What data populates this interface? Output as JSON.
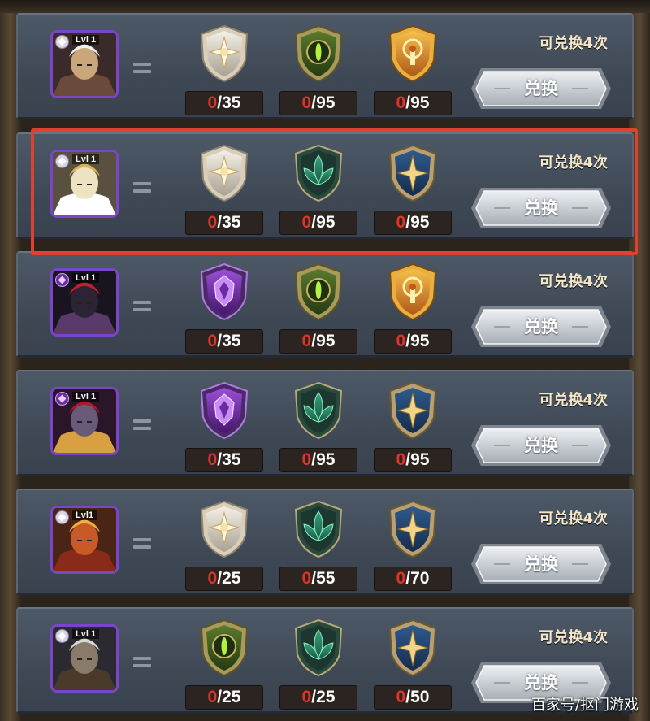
{
  "exchange_list": {
    "items": [
      {
        "hero": "hero-white-haired-warrior",
        "faction": "celestial",
        "level_label": "Lvl 1",
        "materials": [
          {
            "emblem": "star-emblem",
            "have": "0",
            "need": "/35"
          },
          {
            "emblem": "eye-emblem",
            "have": "0",
            "need": "/95"
          },
          {
            "emblem": "gold-emblem",
            "have": "0",
            "need": "/95"
          }
        ],
        "limit_text": "可兑换4次",
        "button_label": "兑换"
      },
      {
        "hero": "hero-golden-winged-knight",
        "faction": "celestial",
        "level_label": "Lvl 1",
        "materials": [
          {
            "emblem": "star-emblem",
            "have": "0",
            "need": "/35"
          },
          {
            "emblem": "lotus-emblem",
            "have": "0",
            "need": "/95"
          },
          {
            "emblem": "blue-star-emblem",
            "have": "0",
            "need": "/95"
          }
        ],
        "limit_text": "可兑换4次",
        "button_label": "兑换"
      },
      {
        "hero": "hero-dark-horned-demon",
        "faction": "hypogean",
        "level_label": "Lvl 1",
        "materials": [
          {
            "emblem": "purple-emblem",
            "have": "0",
            "need": "/35"
          },
          {
            "emblem": "eye-emblem",
            "have": "0",
            "need": "/95"
          },
          {
            "emblem": "gold-emblem",
            "have": "0",
            "need": "/95"
          }
        ],
        "limit_text": "可兑换4次",
        "button_label": "兑换"
      },
      {
        "hero": "hero-crimson-vampire",
        "faction": "hypogean",
        "level_label": "Lvl 1",
        "materials": [
          {
            "emblem": "purple-emblem",
            "have": "0",
            "need": "/35"
          },
          {
            "emblem": "lotus-emblem",
            "have": "0",
            "need": "/95"
          },
          {
            "emblem": "blue-star-emblem",
            "have": "0",
            "need": "/95"
          }
        ],
        "limit_text": "可兑换4次",
        "button_label": "兑换"
      },
      {
        "hero": "hero-monkey-king",
        "faction": "celestial",
        "level_label": "Lvl1",
        "materials": [
          {
            "emblem": "star-emblem",
            "have": "0",
            "need": "/25"
          },
          {
            "emblem": "lotus-emblem",
            "have": "0",
            "need": "/55"
          },
          {
            "emblem": "blue-star-emblem",
            "have": "0",
            "need": "/70"
          }
        ],
        "limit_text": "可兑换4次",
        "button_label": "兑换"
      },
      {
        "hero": "hero-grey-bearded-veteran",
        "faction": "celestial",
        "level_label": "Lvl 1",
        "materials": [
          {
            "emblem": "eye-emblem",
            "have": "0",
            "need": "/25"
          },
          {
            "emblem": "lotus-emblem",
            "have": "0",
            "need": "/25"
          },
          {
            "emblem": "blue-star-emblem",
            "have": "0",
            "need": "/50"
          }
        ],
        "limit_text": "可兑换4次",
        "button_label": "兑换"
      }
    ]
  },
  "watermark": "百家号/抠门游戏",
  "colors": {
    "row_bg": "#46505d",
    "count_have": "#e0342a",
    "highlight_border": "#e0402e",
    "portrait_border": "#7b46c6"
  }
}
